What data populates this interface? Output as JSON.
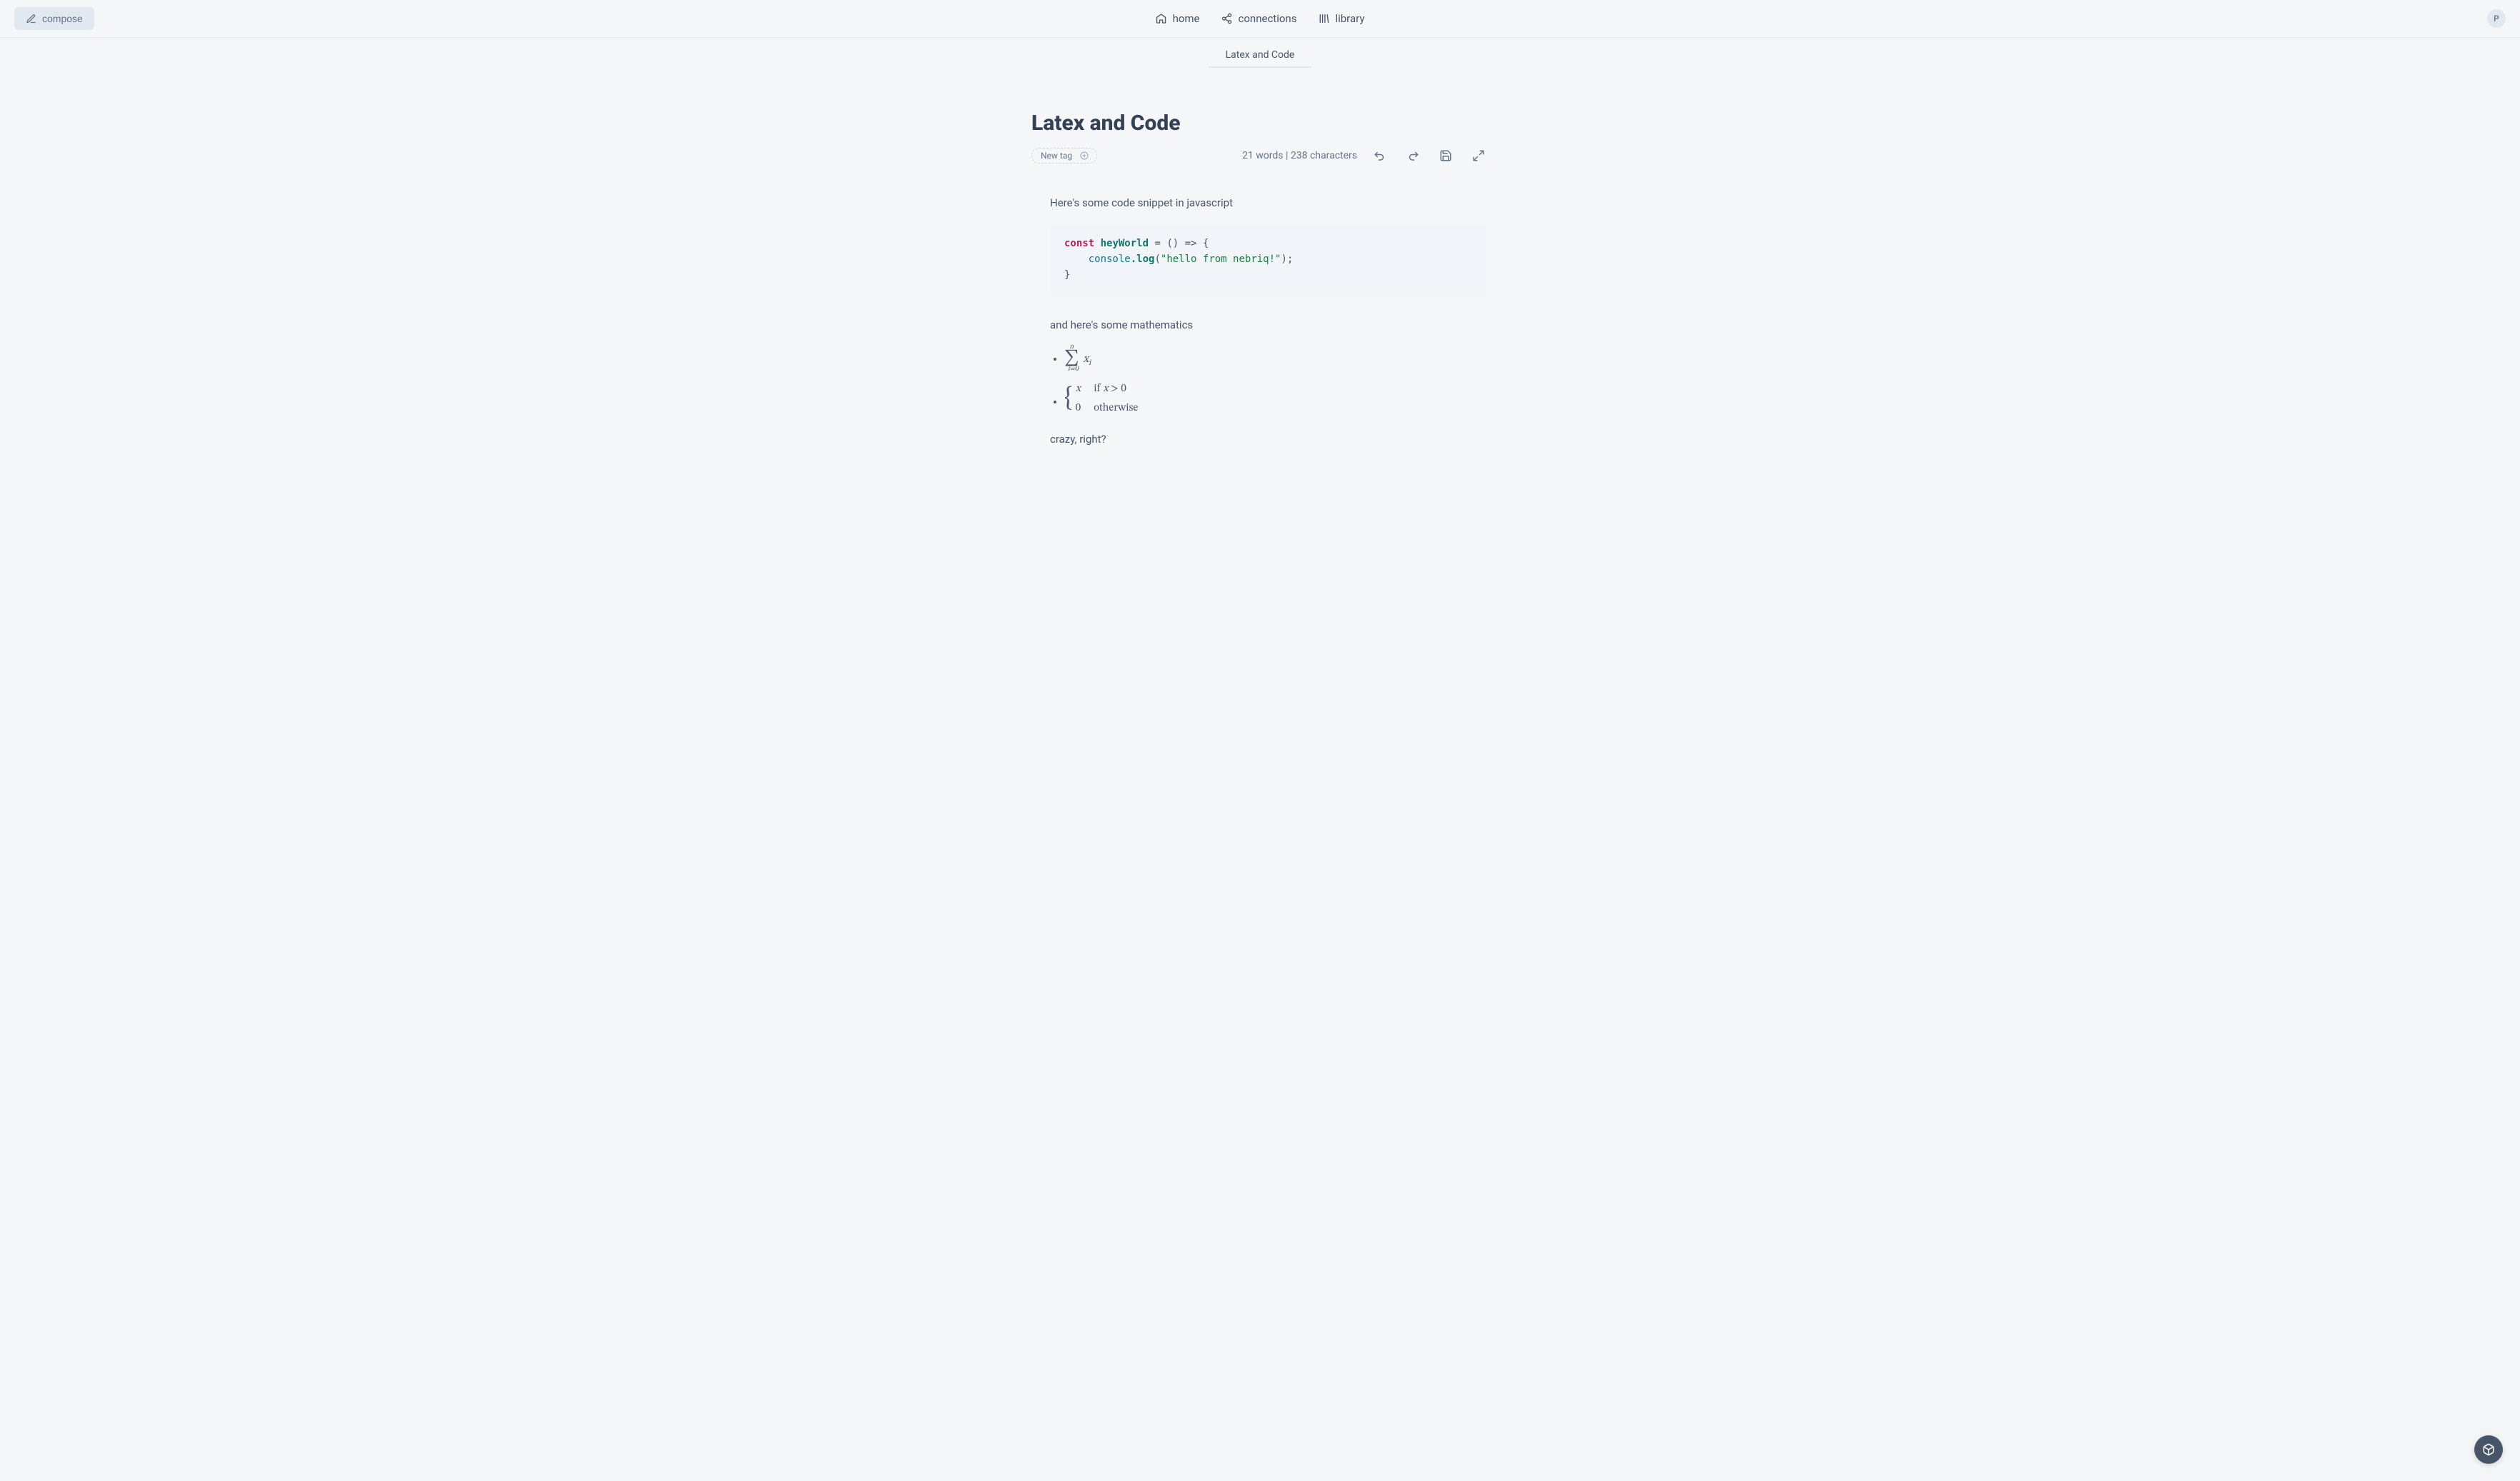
{
  "topbar": {
    "compose_label": "compose",
    "nav": {
      "home": "home",
      "connections": "connections",
      "library": "library"
    },
    "avatar_initial": "P"
  },
  "tabs": {
    "active": "Latex and Code"
  },
  "document": {
    "title": "Latex and Code",
    "tag_placeholder": "New tag",
    "stats": "21 words | 238 characters"
  },
  "editor": {
    "intro": "Here's some code snippet in javascript",
    "code": {
      "keyword": "const",
      "func_name": "heyWorld",
      "arrow_part": " = () => {",
      "console_ident": "console",
      "dot_log": ".log",
      "open_paren": "(",
      "string_literal": "\"hello from nebriq!\"",
      "close_stmt": ");",
      "close_brace": "}"
    },
    "math_intro": "and here's some mathematics",
    "math1": {
      "upper": "n",
      "lower": "i=0",
      "var": "x",
      "sub": "i"
    },
    "math2": {
      "row1_val": "x",
      "row1_cond_prefix": "if ",
      "row1_cond_var": "x",
      "row1_cond_rest": " > 0",
      "row2_val": "0",
      "row2_cond": "otherwise"
    },
    "outro": "crazy, right?"
  }
}
